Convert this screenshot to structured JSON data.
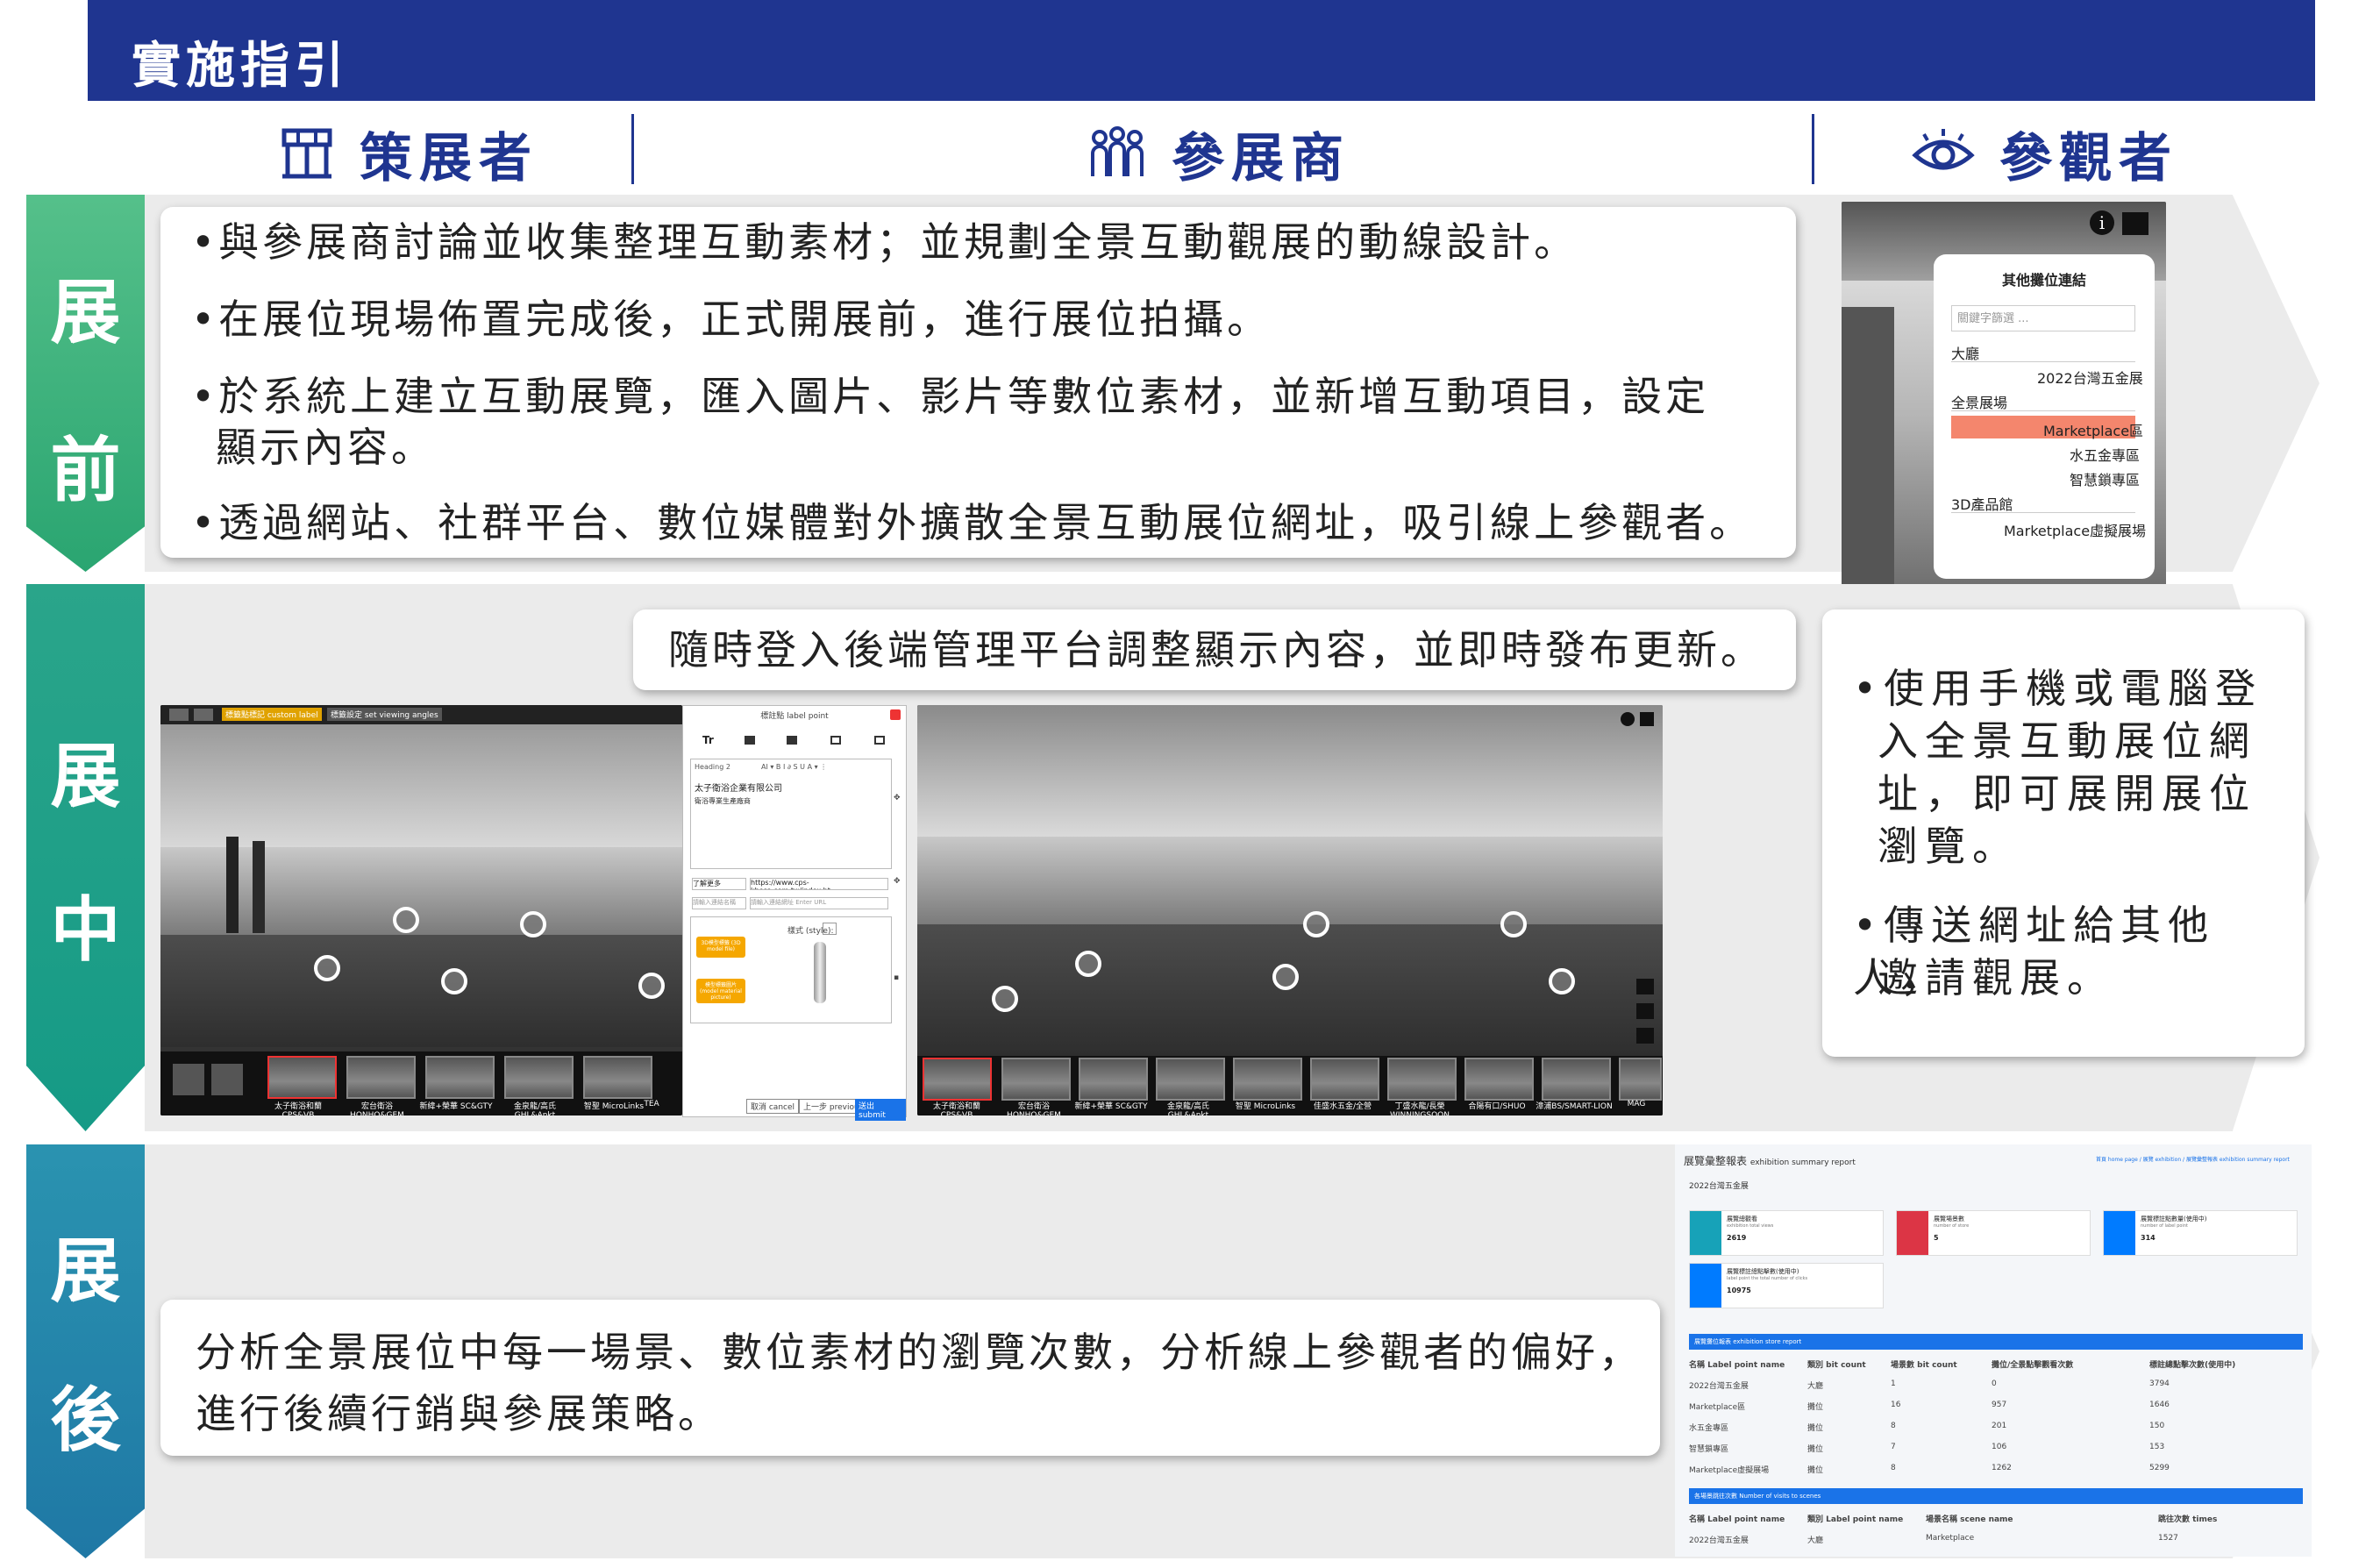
{
  "header": {
    "title": "實施指引"
  },
  "roles": [
    {
      "label": "策展者",
      "icon": "curator-icon"
    },
    {
      "label": "參展商",
      "icon": "exhibitors-icon"
    },
    {
      "label": "參觀者",
      "icon": "eye-icon"
    }
  ],
  "phases": {
    "before": {
      "label_1": "展",
      "label_2": "前",
      "bullets": [
        "與參展商討論並收集整理互動素材；並規劃全景互動觀展的動線設計。",
        "在展位現場佈置完成後，正式開展前，進行展位拍攝。",
        "於系統上建立互動展覽，匯入圖片、影片等數位素材，並新增互動項目，設定",
        "顯示內容。",
        "透過網站、社群平台、數位媒體對外擴散全景互動展位網址，吸引線上參觀者。"
      ]
    },
    "during": {
      "label_1": "展",
      "label_2": "中",
      "exhibitor_note": "隨時登入後端管理平台調整顯示內容，並即時發布更新。",
      "visitor_lines": [
        "使用手機或電腦登",
        "入全景互動展位網",
        "址，即可展開展位",
        "瀏覽。",
        "傳送網址給其他人，",
        "邀請觀展。"
      ]
    },
    "after": {
      "label_1": "展",
      "label_2": "後",
      "lines": [
        "分析全景展位中每一場景、數位素材的瀏覽次數，分析線上參觀者的偏好，",
        "進行後續行銷與參展策略。"
      ]
    }
  },
  "booth_menu": {
    "title": "其他攤位連結",
    "search_placeholder": "關鍵字篩選 ...",
    "items": [
      "大廳",
      "2022台灣五金展",
      "全景展場",
      "Marketplace區",
      "水五金專區",
      "智慧鎖專區",
      "3D產品館",
      "Marketplace虛擬展場"
    ]
  },
  "editor": {
    "toolbar_left": "標籤點標記 custom label",
    "toolbar_mid": "標籤設定 set viewing angles",
    "panel_title": "標註點 label point",
    "heading_select": "Heading 2",
    "content_title": "太子衛浴企業有限公司",
    "content_sub": "衛浴專業生產廠商",
    "link_label": "了解更多",
    "link_url": "https://www.cps-kbosa.com.tw/index.ht",
    "link_placeholder_1": "請輸入連結名稱",
    "link_placeholder_2": "請輸入連結網址 Enter URL",
    "btn_3d": "3D模型標籤 (3D model file)",
    "btn_model": "模型標籤圖片 (model material picture)",
    "style_label": "樣式 (style):",
    "cancel": "取消 cancel",
    "prev": "上一步 previous",
    "submit": "送出 submit"
  },
  "thumbs_left": [
    "太子衛浴和蘭 CPS&VB",
    "宏台衛浴 HONHO&GEM",
    "新緯+榮華 SC&GTY",
    "金泉龍/高氏 GHL&Ankt",
    "智聖 MicroLinks",
    "TEA"
  ],
  "thumbs_right": [
    "太子衛浴和蘭 CPS&VB",
    "宏台衛浴 HONHO&GEM",
    "新緯+榮華 SC&GTY",
    "金泉龍/高氏 GHL&Ankt",
    "智聖 MicroLinks",
    "佳盛水五金/全營",
    "丁盛水龍/長榮 WINNINGSOON",
    "合陽有口/SHUO",
    "漳浦BS/SMART-LION",
    "MAG"
  ],
  "report": {
    "title": "展覽彙整報表",
    "title_en": "exhibition summary report",
    "crumbs": "首頁 home page / 展覽 exhibition / 展覽彙整報表 exhibition summary report",
    "exhibition_name": "2022台灣五金展",
    "stats": [
      {
        "label": "展覽總觀看",
        "en": "exhibition total views",
        "value": "2619",
        "color": "#17a2b8"
      },
      {
        "label": "展覽場景數",
        "en": "number of store",
        "value": "5",
        "color": "#dc3545"
      },
      {
        "label": "展覽標註點數量(使用中)",
        "en": "number of label point",
        "value": "314",
        "color": "#007bff"
      },
      {
        "label": "展覽標註總點擊數(使用中)",
        "en": "label point the total number of clicks",
        "value": "10975",
        "color": "#007bff"
      }
    ],
    "table1": {
      "title": "展覽攤位報表",
      "title_en": "exhibition store report",
      "headers": [
        "名稱 Label point name",
        "類別 bit count",
        "場景數 bit count",
        "攤位/全景點擊觀看次數",
        "標註總點擊次數(使用中)"
      ],
      "rows": [
        [
          "2022台灣五金展",
          "大廳",
          "1",
          "0",
          "3794"
        ],
        [
          "Marketplace區",
          "攤位",
          "16",
          "957",
          "1646"
        ],
        [
          "水五金專區",
          "攤位",
          "8",
          "201",
          "150"
        ],
        [
          "智慧鎖專區",
          "攤位",
          "7",
          "106",
          "153"
        ],
        [
          "Marketplace虛擬展場",
          "攤位",
          "8",
          "1262",
          "5299"
        ]
      ]
    },
    "table2": {
      "title": "各場景跳往次數",
      "title_en": "Number of visits to scenes",
      "headers": [
        "名稱 Label point name",
        "類別 Label point name",
        "場景名稱 scene name",
        "跳往次數 times"
      ],
      "rows": [
        [
          "2022台灣五金展",
          "大廳",
          "Marketplace",
          "1527"
        ]
      ]
    }
  }
}
